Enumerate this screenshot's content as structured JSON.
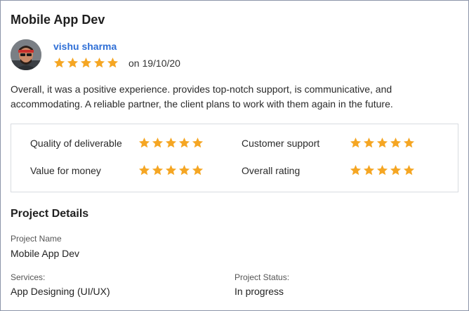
{
  "card": {
    "title": "Mobile App Dev"
  },
  "reviewer": {
    "name": "vishu sharma",
    "rating": 5,
    "date_text": "on 19/10/20",
    "avatar_icon": "person-avatar"
  },
  "review": {
    "text": "Overall, it was a positive experience. provides top-notch support, is communicative, and accommodating. A reliable partner, the client plans to work with them again in the future."
  },
  "ratings": {
    "quality": {
      "label": "Quality of deliverable",
      "stars": 5
    },
    "support": {
      "label": "Customer support",
      "stars": 5
    },
    "value": {
      "label": "Value for money",
      "stars": 5
    },
    "overall": {
      "label": "Overall rating",
      "stars": 5
    }
  },
  "project": {
    "section_title": "Project Details",
    "name_label": "Project Name",
    "name_value": "Mobile App Dev",
    "services_label": "Services:",
    "services_value": "App Designing (UI/UX)",
    "status_label": "Project Status:",
    "status_value": "In progress"
  },
  "colors": {
    "star": "#f5a623",
    "link": "#2f6fd6",
    "border": "#d8dbe0"
  }
}
